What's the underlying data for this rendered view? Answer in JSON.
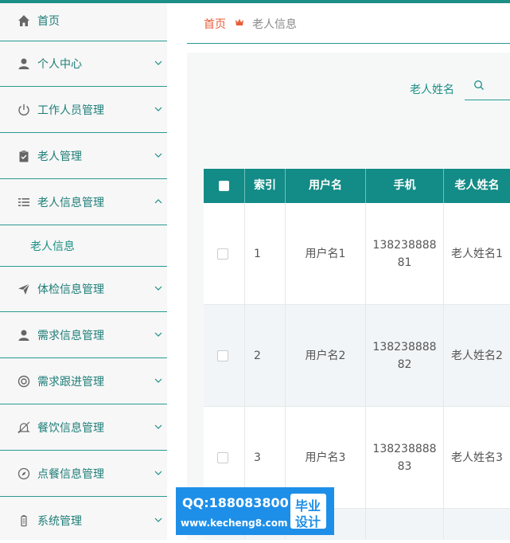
{
  "sidebar": {
    "items": [
      {
        "label": "首页",
        "icon": "home-icon"
      },
      {
        "label": "个人中心",
        "icon": "user-icon"
      },
      {
        "label": "工作人员管理",
        "icon": "power-icon"
      },
      {
        "label": "老人管理",
        "icon": "clipboard-icon"
      },
      {
        "label": "老人信息管理",
        "icon": "list-icon",
        "expanded": true
      },
      {
        "label": "体检信息管理",
        "icon": "send-icon"
      },
      {
        "label": "需求信息管理",
        "icon": "user-icon"
      },
      {
        "label": "需求跟进管理",
        "icon": "lifebuoy-icon"
      },
      {
        "label": "餐饮信息管理",
        "icon": "bell-off-icon"
      },
      {
        "label": "点餐信息管理",
        "icon": "compass-icon"
      },
      {
        "label": "系统管理",
        "icon": "battery-icon"
      }
    ],
    "sub_item": "老人信息"
  },
  "breadcrumb": {
    "home": "首页",
    "current": "老人信息"
  },
  "search": {
    "label": "老人姓名"
  },
  "table": {
    "headers": [
      "索引",
      "用户名",
      "手机",
      "老人姓名"
    ],
    "rows": [
      {
        "index": "1",
        "username": "用户名1",
        "phone_a": "138238888",
        "phone_b": "81",
        "elder_name": "老人姓名1"
      },
      {
        "index": "2",
        "username": "用户名2",
        "phone_a": "138238888",
        "phone_b": "82",
        "elder_name": "老人姓名2"
      },
      {
        "index": "3",
        "username": "用户名3",
        "phone_a": "138238888",
        "phone_b": "83",
        "elder_name": "老人姓名3"
      }
    ]
  },
  "watermark": {
    "qq": "QQ:188083800",
    "url": "www.kecheng8.com",
    "badge_line1": "毕业",
    "badge_line2": "设计"
  },
  "colors": {
    "accent": "#1c8f86",
    "header_bg": "#138b86",
    "home_link": "#e85d3a",
    "watermark_bg": "#1e8fe8"
  }
}
